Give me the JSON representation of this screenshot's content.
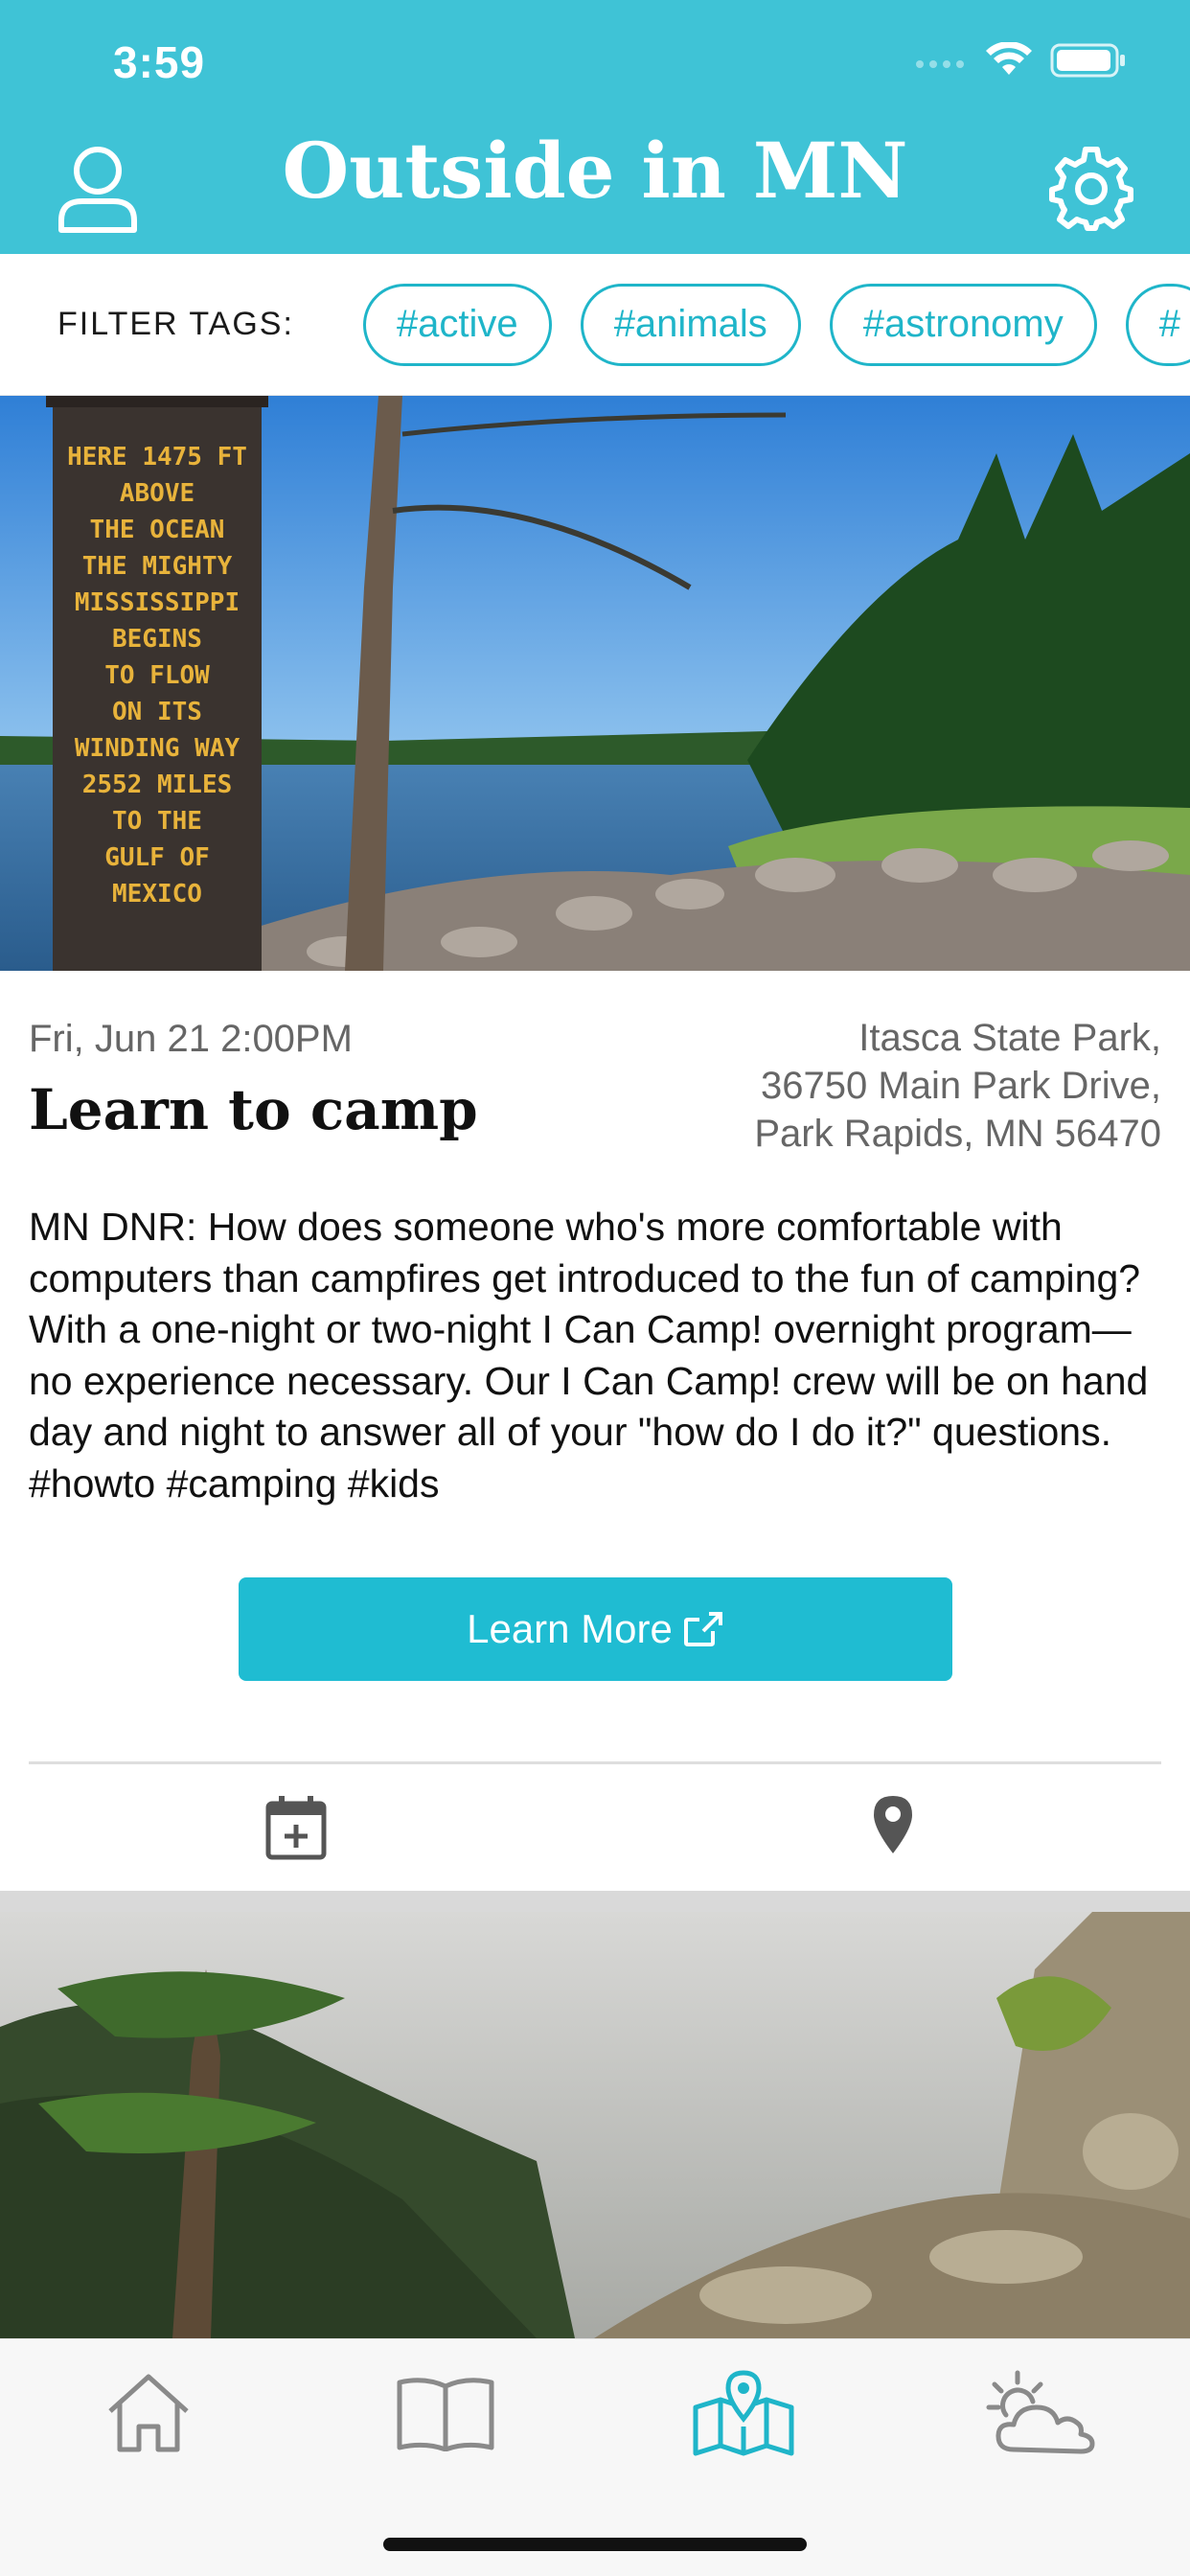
{
  "status_bar": {
    "time": "3:59",
    "signal_icon": "cellular-signal-icon",
    "wifi_icon": "wifi-icon",
    "battery_icon": "battery-icon"
  },
  "header": {
    "title": "Outside in MN",
    "profile_icon": "person-icon",
    "settings_icon": "gear-icon",
    "background_color": "#3fc3d6"
  },
  "filter": {
    "label": "FILTER TAGS:",
    "tags": [
      "#active",
      "#animals",
      "#astronomy",
      "#"
    ]
  },
  "event": {
    "image_description": "lake-with-sign-photo",
    "date": "Fri, Jun 21 2:00PM",
    "title": "Learn to camp",
    "location_lines": [
      "Itasca State Park,",
      "36750 Main Park Drive,",
      "Park Rapids, MN 56470"
    ],
    "description": "MN DNR: How does someone who's more comfortable with computers than campfires get introduced to the fun of camping? With a one-night or two-night I Can Camp! overnight program—no experience necessary. Our I Can Camp! crew will be on hand day and night to answer all of your \"how do I do it?\" questions. #howto #camping #kids",
    "sign_text": "HERE 1475 FT ABOVE THE OCEAN THE MIGHTY MISSISSIPPI BEGINS TO FLOW ON ITS WINDING WAY 2552 MILES TO THE GULF OF MEXICO",
    "learn_more_label": "Learn More",
    "add_calendar_icon": "calendar-add-icon",
    "map_pin_icon": "map-pin-icon",
    "accent_color": "#1fbcd2"
  },
  "tabs": [
    {
      "name": "home",
      "icon": "home-icon",
      "active": false
    },
    {
      "name": "guide",
      "icon": "book-icon",
      "active": false
    },
    {
      "name": "map",
      "icon": "map-icon",
      "active": true
    },
    {
      "name": "weather",
      "icon": "weather-icon",
      "active": false
    }
  ]
}
